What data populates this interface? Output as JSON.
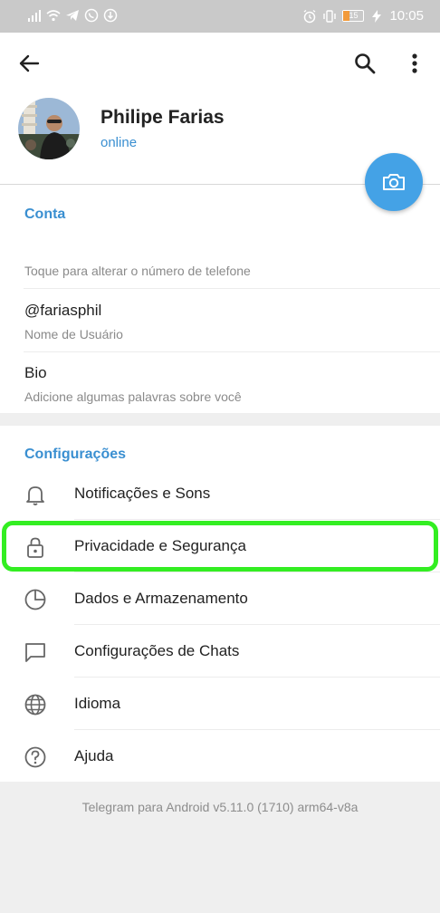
{
  "status_bar": {
    "time": "10:05",
    "battery_level": "15",
    "left_icons": [
      "signal-icon",
      "wifi-icon",
      "telegram-icon",
      "whatsapp-icon",
      "download-icon"
    ],
    "right_icons": [
      "alarm-icon",
      "vibrate-icon",
      "battery-icon",
      "charging-icon"
    ]
  },
  "profile": {
    "name": "Philipe Farias",
    "status": "online"
  },
  "account": {
    "title": "Conta",
    "phone_hint": "Toque para alterar o número de telefone",
    "username": "@fariasphil",
    "username_hint": "Nome de Usuário",
    "bio": "Bio",
    "bio_hint": "Adicione algumas palavras sobre você"
  },
  "settings": {
    "title": "Configurações",
    "items": [
      {
        "label": "Notificações e Sons",
        "icon": "bell-icon"
      },
      {
        "label": "Privacidade e Segurança",
        "icon": "lock-icon"
      },
      {
        "label": "Dados e Armazenamento",
        "icon": "pie-chart-icon"
      },
      {
        "label": "Configurações de Chats",
        "icon": "chat-bubble-icon"
      },
      {
        "label": "Idioma",
        "icon": "globe-icon"
      },
      {
        "label": "Ajuda",
        "icon": "help-icon"
      }
    ]
  },
  "footer": {
    "version": "Telegram para Android v5.11.0 (1710) arm64-v8a"
  },
  "colors": {
    "accent": "#3a8fd1",
    "fab": "#44a2e6",
    "highlight": "#33ee22",
    "status_bar": "#c9c9c9"
  }
}
